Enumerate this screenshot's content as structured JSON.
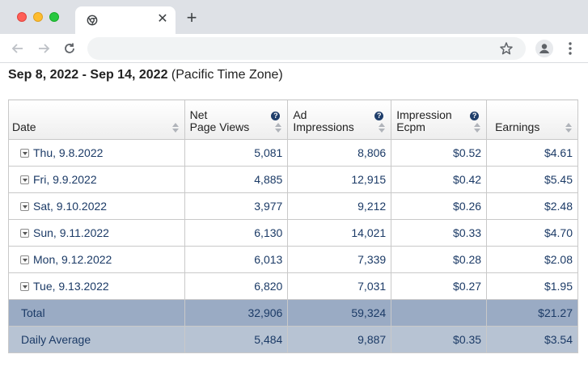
{
  "browser": {
    "new_tab_glyph": "+",
    "close_glyph": "✕",
    "address_value": ""
  },
  "report": {
    "date_range": "Sep 8, 2022 - Sep 14, 2022",
    "timezone": "(Pacific Time Zone)",
    "columns": {
      "date": "Date",
      "net_page_views_1": "Net",
      "net_page_views_2": "Page Views",
      "ad_impressions_1": "Ad",
      "ad_impressions_2": "Impressions",
      "ecpm_1": "Impression",
      "ecpm_2": "Ecpm",
      "earnings": "Earnings"
    },
    "rows": [
      {
        "date": "Thu, 9.8.2022",
        "views": "5,081",
        "impressions": "8,806",
        "ecpm": "$0.52",
        "earnings": "$4.61"
      },
      {
        "date": "Fri, 9.9.2022",
        "views": "4,885",
        "impressions": "12,915",
        "ecpm": "$0.42",
        "earnings": "$5.45"
      },
      {
        "date": "Sat, 9.10.2022",
        "views": "3,977",
        "impressions": "9,212",
        "ecpm": "$0.26",
        "earnings": "$2.48"
      },
      {
        "date": "Sun, 9.11.2022",
        "views": "6,130",
        "impressions": "14,021",
        "ecpm": "$0.33",
        "earnings": "$4.70"
      },
      {
        "date": "Mon, 9.12.2022",
        "views": "6,013",
        "impressions": "7,339",
        "ecpm": "$0.28",
        "earnings": "$2.08"
      },
      {
        "date": "Tue, 9.13.2022",
        "views": "6,820",
        "impressions": "7,031",
        "ecpm": "$0.27",
        "earnings": "$1.95"
      }
    ],
    "total": {
      "label": "Total",
      "views": "32,906",
      "impressions": "59,324",
      "ecpm": "",
      "earnings": "$21.27"
    },
    "average": {
      "label": "Daily Average",
      "views": "5,484",
      "impressions": "9,887",
      "ecpm": "$0.35",
      "earnings": "$3.54"
    }
  }
}
